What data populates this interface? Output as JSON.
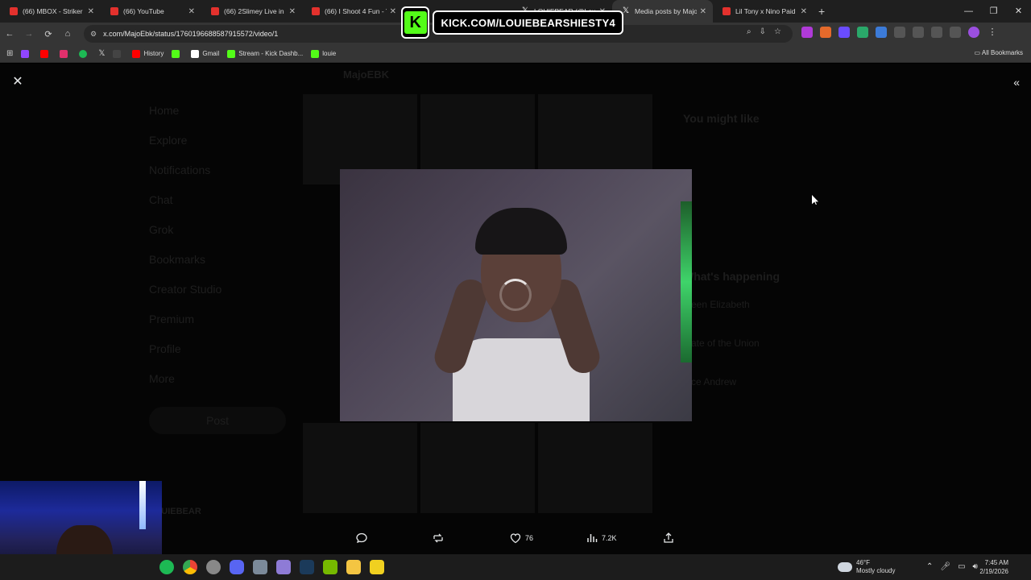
{
  "browser": {
    "tabs": [
      {
        "title": "(66) MBOX - Striker Sl",
        "favicon": "youtube-icon",
        "active": false
      },
      {
        "title": "(66) YouTube",
        "favicon": "youtube-icon",
        "active": false
      },
      {
        "title": "(66) 2Slimey Live in N",
        "favicon": "youtube-icon",
        "active": false
      },
      {
        "title": "(66) I Shoot 4 Fun - Yo",
        "favicon": "youtube-icon",
        "active": false
      },
      {
        "title": "LOUIEBEAR (@LouieB",
        "favicon": "x-icon",
        "active": false
      },
      {
        "title": "Media posts by Majo",
        "favicon": "x-icon",
        "active": true
      },
      {
        "title": "Lil Tony x Nino Paid -",
        "favicon": "youtube-icon",
        "active": false
      }
    ],
    "url": "x.com/MajoEbk/status/1760196688587915572/video/1",
    "bookmarks": [
      {
        "label": "",
        "color": "#9146ff"
      },
      {
        "label": "",
        "color": "#ff0000"
      },
      {
        "label": "",
        "color": "#e1306c"
      },
      {
        "label": "",
        "color": "#1db954"
      },
      {
        "label": "",
        "color": "#ffffff"
      },
      {
        "label": "",
        "color": "#444444"
      },
      {
        "label": "History",
        "color": "#ff0000"
      },
      {
        "label": "",
        "color": "#53fc18"
      },
      {
        "label": "Gmail",
        "color": "#ffffff"
      },
      {
        "label": "Stream - Kick Dashb...",
        "color": "#53fc18"
      },
      {
        "label": "louie",
        "color": "#53fc18"
      }
    ],
    "all_bookmarks_label": "All Bookmarks"
  },
  "overlay": {
    "kick_url": "KICK.COM/LOUIEBEARSHIESTY4",
    "kick_logo": "K"
  },
  "page": {
    "header": "MajoEBK",
    "nav": [
      "Home",
      "Explore",
      "Notifications",
      "Chat",
      "Grok",
      "Bookmarks",
      "Creator Studio",
      "Premium",
      "Profile",
      "More"
    ],
    "post_button": "Post",
    "you_might_like": "You might like",
    "whats_happening": "What's happening",
    "trends": [
      "...een Elizabeth",
      "...ate of the Union",
      "...ce Andrew"
    ],
    "account_name": "LOUIEBEAR"
  },
  "media_viewer": {
    "likes": "76",
    "views": "7.2K"
  },
  "taskbar": {
    "weather_temp": "46°F",
    "weather_desc": "Mostly cloudy",
    "time": "7:45 AM",
    "date": "2/19/2026"
  }
}
